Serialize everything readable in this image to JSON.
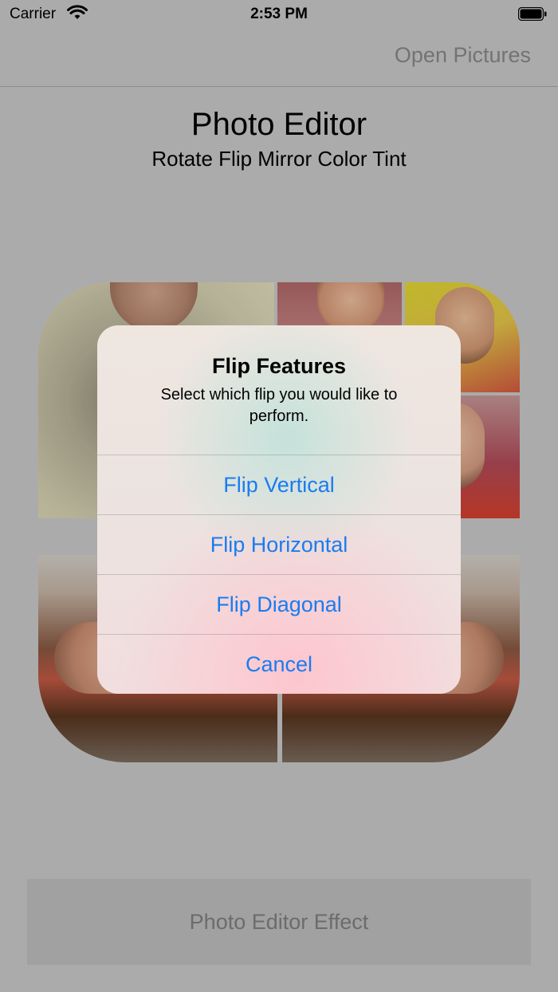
{
  "status_bar": {
    "carrier": "Carrier",
    "time": "2:53 PM"
  },
  "nav": {
    "right_button": "Open Pictures"
  },
  "header": {
    "title": "Photo  Editor",
    "subtitle": "Rotate Flip Mirror Color Tint"
  },
  "footer": {
    "button_label": "Photo Editor Effect"
  },
  "alert": {
    "title": "Flip Features",
    "message": "Select which flip you would like to perform.",
    "actions": [
      "Flip Vertical",
      "Flip Horizontal",
      "Flip Diagonal",
      "Cancel"
    ]
  },
  "colors": {
    "tint": "#1a7cf0",
    "background": "#cccccc",
    "nav_button": "#8a8a8a"
  }
}
